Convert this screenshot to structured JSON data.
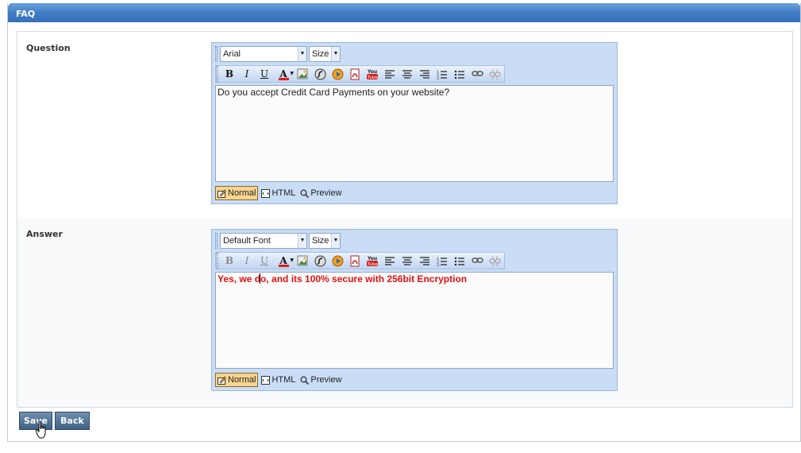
{
  "header": {
    "title": "FAQ"
  },
  "question": {
    "label": "Question",
    "font": "Arial",
    "size": "Size",
    "content": "Do you accept Credit Card Payments on your website?"
  },
  "answer": {
    "label": "Answer",
    "font": "Default Font",
    "size": "Size",
    "content_before_caret": "Yes, we d",
    "content_after_caret": "o, and its 100% secure with 256bit Encryption",
    "text_color": "#e81010"
  },
  "modes": {
    "normal": "Normal",
    "html": "HTML",
    "preview": "Preview"
  },
  "toolbar_icons": [
    "bold-icon",
    "italic-icon",
    "underline-icon",
    "font-color-icon",
    "image-icon",
    "flash-icon",
    "media-icon",
    "pdf-icon",
    "youtube-icon",
    "align-left-icon",
    "align-center-icon",
    "align-right-icon",
    "ordered-list-icon",
    "unordered-list-icon",
    "link-icon",
    "unlink-icon"
  ],
  "buttons": {
    "save": "Save",
    "back": "Back"
  },
  "colors": {
    "header": "#3f7ac4",
    "toolbar_bg": "#c9ddf6",
    "button": "#4f7293",
    "active_mode": "#f8d58f"
  }
}
